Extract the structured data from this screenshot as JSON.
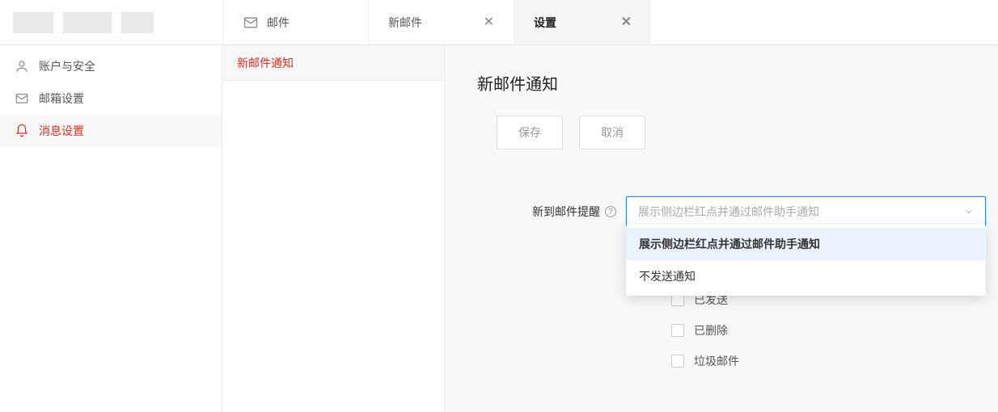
{
  "tabs": {
    "mail": "邮件",
    "compose": "新邮件",
    "settings": "设置"
  },
  "sidebar": {
    "items": [
      {
        "label": "账户与安全"
      },
      {
        "label": "邮箱设置"
      },
      {
        "label": "消息设置"
      }
    ]
  },
  "subpanel": {
    "item": "新邮件通知"
  },
  "content": {
    "title": "新邮件通知",
    "save": "保存",
    "cancel": "取消",
    "form_label": "新到邮件提醒",
    "select_placeholder": "展示侧边栏红点并通过邮件助手通知",
    "dropdown": [
      "展示侧边栏红点并通过邮件助手通知",
      "不发送通知"
    ],
    "checkboxes": [
      "已发送",
      "已删除",
      "垃圾邮件"
    ]
  }
}
